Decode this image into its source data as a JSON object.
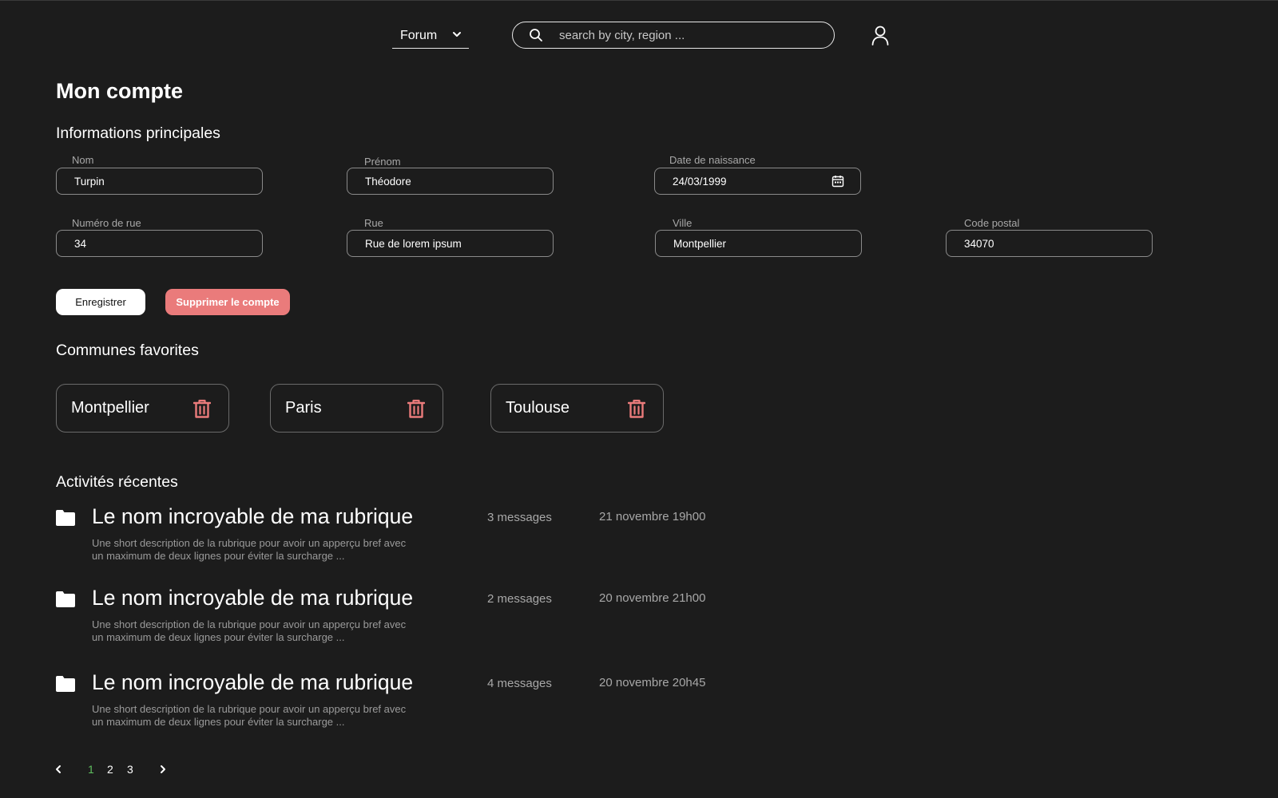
{
  "header": {
    "forum_label": "Forum",
    "search_placeholder": "search by city, region ..."
  },
  "page_title": "Mon compte",
  "main_info": {
    "heading": "Informations principales",
    "fields": {
      "nom": {
        "label": "Nom",
        "value": "Turpin"
      },
      "prenom": {
        "label": "Prénom",
        "value": "Théodore"
      },
      "naissance": {
        "label": "Date de naissance",
        "value": "24/03/1999"
      },
      "numero": {
        "label": "Numéro de rue",
        "value": "34"
      },
      "rue": {
        "label": "Rue",
        "value": "Rue de lorem ipsum"
      },
      "ville": {
        "label": "Ville",
        "value": "Montpellier"
      },
      "cp": {
        "label": "Code postal",
        "value": "34070"
      }
    },
    "save_label": "Enregistrer",
    "delete_label": "Supprimer le compte"
  },
  "favorites": {
    "heading": "Communes favorites",
    "items": [
      "Montpellier",
      "Paris",
      "Toulouse"
    ]
  },
  "activities": {
    "heading": "Activités récentes",
    "items": [
      {
        "title": "Le nom incroyable de ma rubrique",
        "desc1": "Une short description de la rubrique pour avoir un apperçu bref avec",
        "desc2": "un maximum de deux lignes pour éviter la surcharge ...",
        "count": "3 messages",
        "date": "21 novembre 19h00"
      },
      {
        "title": "Le nom incroyable de ma rubrique",
        "desc1": "Une short description de la rubrique pour avoir un apperçu bref avec",
        "desc2": "un maximum de deux lignes pour éviter la surcharge ...",
        "count": "2 messages",
        "date": "20 novembre 21h00"
      },
      {
        "title": "Le nom incroyable de ma rubrique",
        "desc1": "Une short description de la rubrique pour avoir un apperçu bref avec",
        "desc2": "un maximum de deux lignes pour éviter la surcharge ...",
        "count": "4 messages",
        "date": "20 novembre 20h45"
      }
    ]
  },
  "pagination": {
    "pages": [
      "1",
      "2",
      "3"
    ],
    "current": "1"
  },
  "colors": {
    "background": "#1c1c1c",
    "danger": "#ea7b7b",
    "active_page": "#5fbf5f"
  }
}
